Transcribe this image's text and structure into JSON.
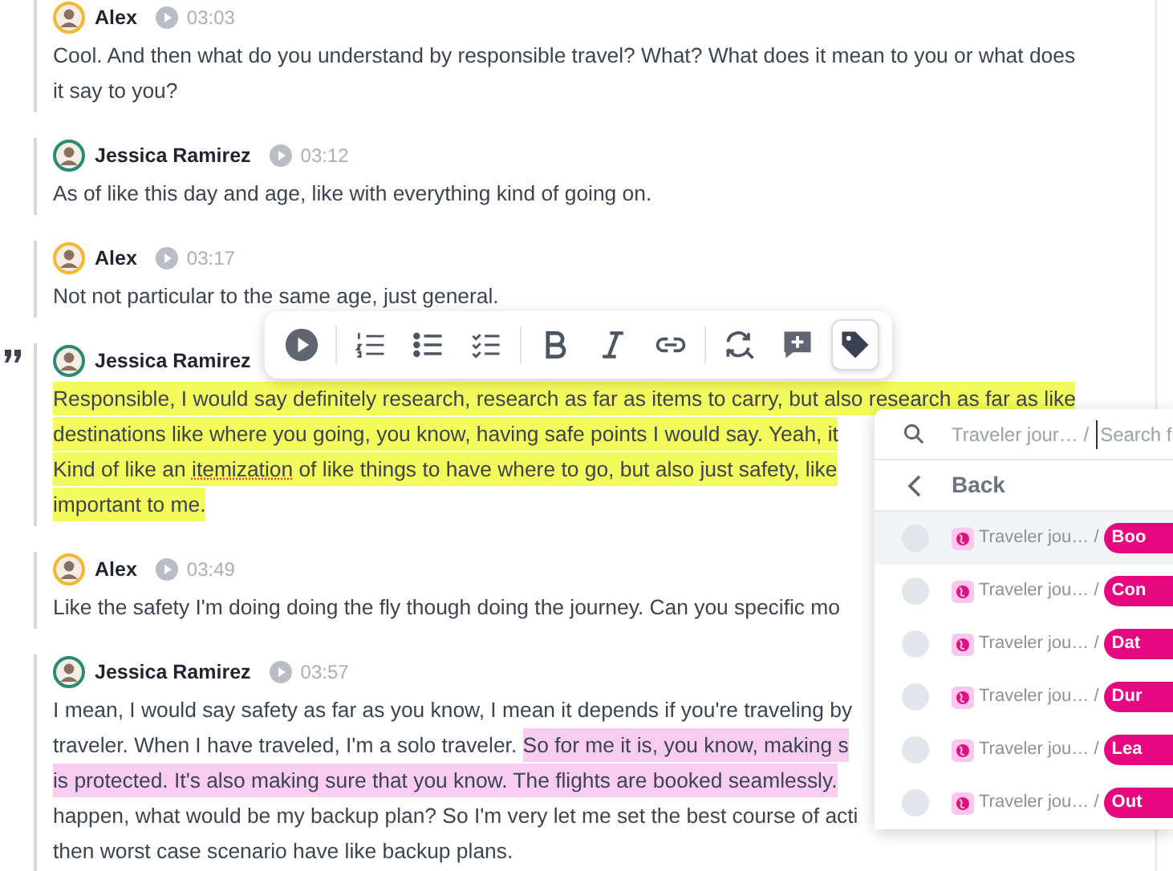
{
  "transcript": [
    {
      "speaker": "Alex",
      "color": "#f5b82e",
      "time": "03:03",
      "lines": [
        [
          {
            "text": "Cool. And then what do you understand by responsible travel? What? What does it mean to you or what does"
          }
        ],
        [
          {
            "text": "it say to you?"
          }
        ]
      ]
    },
    {
      "speaker": "Jessica Ramirez",
      "color": "#2a8a74",
      "time": "03:12",
      "lines": [
        [
          {
            "text": "As of like this day and age, like with everything kind of going on."
          }
        ]
      ]
    },
    {
      "speaker": "Alex",
      "color": "#f5b82e",
      "time": "03:17",
      "lines": [
        [
          {
            "text": "Not not particular to the same age, just general."
          }
        ]
      ]
    },
    {
      "speaker": "Jessica Ramirez",
      "color": "#2a8a74",
      "quoted": true,
      "lines": [
        [
          {
            "text": "Responsible, I would say definitely research, research as far as items to carry, but also research as far as like",
            "color": "#f3fa5c"
          }
        ],
        [
          {
            "text": "destinations like where you going, you know, having safe points I would say. Yeah, it",
            "color": "#f3fa5c"
          }
        ],
        [
          {
            "text": "Kind of like an ",
            "color": "#f3fa5c"
          },
          {
            "text": "itemization",
            "color": "#f3fa5c",
            "misspelled": true
          },
          {
            "text": " of like things to have where to go, but also just safety, like",
            "color": "#f3fa5c"
          }
        ],
        [
          {
            "text": "important to me.",
            "color": "#f3fa5c"
          }
        ]
      ]
    },
    {
      "speaker": "Alex",
      "color": "#f5b82e",
      "time": "03:49",
      "lines": [
        [
          {
            "text": "Like the safety I'm doing doing the fly though doing the journey. Can you specific mo"
          }
        ]
      ]
    },
    {
      "speaker": "Jessica Ramirez",
      "color": "#2a8a74",
      "time": "03:57",
      "lines": [
        [
          {
            "text": "I mean, I would say safety as far as you know, I mean it depends if you're traveling by"
          }
        ],
        [
          {
            "text": "traveler. When I have traveled, I'm a solo traveler. "
          },
          {
            "text": "So for me it is, you know, making s",
            "color": "#f9cdef"
          }
        ],
        [
          {
            "text": "is protected. It's also making sure that you know. The flights are booked seamlessly.",
            "color": "#f9cdef"
          }
        ],
        [
          {
            "text": "happen, what would be my backup plan? So I'm very let me set the best course of acti"
          }
        ],
        [
          {
            "text": "then worst case scenario have like backup plans."
          }
        ]
      ]
    }
  ],
  "toolbar": [
    {
      "kind": "play",
      "selected": false
    },
    {
      "kind": "numbered-list",
      "selected": false
    },
    {
      "kind": "bullet-list",
      "selected": false
    },
    {
      "kind": "checklist",
      "selected": false
    },
    {
      "kind": "bold",
      "selected": false
    },
    {
      "kind": "italic",
      "selected": false
    },
    {
      "kind": "link",
      "selected": false
    },
    {
      "kind": "replace",
      "selected": false
    },
    {
      "kind": "comment",
      "selected": false
    },
    {
      "kind": "tag",
      "selected": true
    }
  ],
  "tag_menu": {
    "search": {
      "path": "Traveler jour… /",
      "placeholder": "Search f"
    },
    "back": "Back",
    "items": [
      {
        "path": "Traveler jou… /",
        "tag": "Boo",
        "selected": true
      },
      {
        "path": "Traveler jou… /",
        "tag": "Con",
        "selected": false
      },
      {
        "path": "Traveler jou… /",
        "tag": "Dat",
        "selected": false
      },
      {
        "path": "Traveler jou… /",
        "tag": "Dur",
        "selected": false
      },
      {
        "path": "Traveler jou… /",
        "tag": "Lea",
        "selected": false
      },
      {
        "path": "Traveler jou… /",
        "tag": "Out",
        "selected": false
      }
    ]
  }
}
